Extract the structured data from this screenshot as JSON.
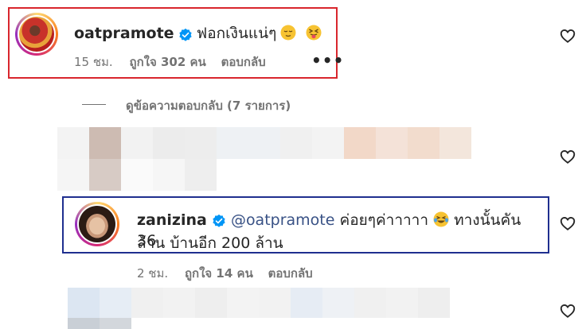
{
  "comment1": {
    "username": "oatpramote",
    "text": "ฟอกเงินแน่ๆ",
    "time": "15 ชม.",
    "likes": "ถูกใจ 302 คน",
    "reply": "ตอบกลับ",
    "more": "•••"
  },
  "replies_toggle": "ดูข้อความตอบกลับ (7 รายการ)",
  "comment2": {
    "username": "zanizina",
    "mention": "@oatpramote",
    "text1": " ค่อยๆค่าาาาา",
    "text2": " ทางนั้นคัน 36",
    "text3": "ล้าน บ้านอีก 200 ล้าน",
    "time": "2 ชม.",
    "likes": "ถูกใจ 14 คน",
    "reply": "ตอบกลับ"
  },
  "colors": {
    "highlight_red": "#d9262d",
    "highlight_blue": "#1f2f8f",
    "verified": "#0095f6",
    "mention": "#385185"
  },
  "icons": [
    "verified-badge-icon",
    "heart-icon",
    "more-icon",
    "relieved-emoji-icon",
    "tongue-emoji-icon",
    "laughing-emoji-icon"
  ]
}
